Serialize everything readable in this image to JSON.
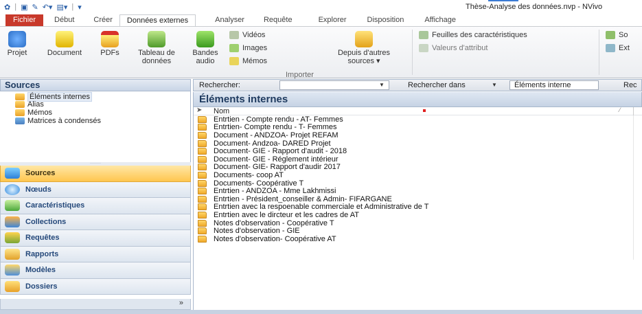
{
  "window": {
    "title": "Thèse-Analyse des données.nvp - NVivo"
  },
  "ribbon_tabs": [
    "Fichier",
    "Début",
    "Créer",
    "Données externes",
    "Analyser",
    "Requête",
    "Explorer",
    "Disposition",
    "Affichage"
  ],
  "ribbon": {
    "projet": "Projet",
    "document": "Document",
    "pdfs": "PDFs",
    "tableau_line1": "Tableau de",
    "tableau_line2": "données",
    "bandes_line1": "Bandes",
    "bandes_line2": "audio",
    "videos": "Vidéos",
    "images": "Images",
    "memos": "Mémos",
    "depuis_line1": "Depuis d'autres",
    "depuis_line2": "sources ▾",
    "group_importer": "Importer",
    "feuilles": "Feuilles des caractéristiques",
    "valeurs": "Valeurs d'attribut",
    "cut_so": "So",
    "cut_ext": "Ext"
  },
  "left_pane": {
    "header": "Sources",
    "tree": [
      "Éléments internes",
      "Alias",
      "Mémos",
      "Matrices à condensés"
    ],
    "nav": [
      "Sources",
      "Nœuds",
      "Caractéristiques",
      "Collections",
      "Requêtes",
      "Rapports",
      "Modèles",
      "Dossiers"
    ],
    "footer_glyph": "»"
  },
  "searchbar": {
    "rechercher_label": "Rechercher:",
    "rechercher_dans_label": "Rechercher dans",
    "scope_value": "Éléments interne",
    "cut_label": "Rec"
  },
  "content": {
    "title": "Éléments internes",
    "column_name": "Nom",
    "items": [
      "Entrtien - Compte rendu - AT- Femmes",
      "Entrtien- Compte rendu - T- Femmes",
      "Document - ANDZOA- Projet  REFAM",
      "Document- Andzoa- DARED Projet",
      "Document- GIE - Rapport d'audit - 2018",
      "Document- GIE - Réglement intérieur",
      "Document- GIE- Rapport d'audir 2017",
      "Documents- coop AT",
      "Documents- Coopérative T",
      "Entrtien - ANDZOA - Mme Lakhmissi",
      "Entrtien - Président_conseiller & Admin- FIFARGANE",
      "Entrtien avec la respoenable commerciale et Administrative de T",
      "Entrtien avec le dircteur et les cadres de AT",
      "Notes d'observation - Coopérative T",
      "Notes d'observation - GIE",
      "Notes d'observation- Coopérative AT"
    ]
  }
}
